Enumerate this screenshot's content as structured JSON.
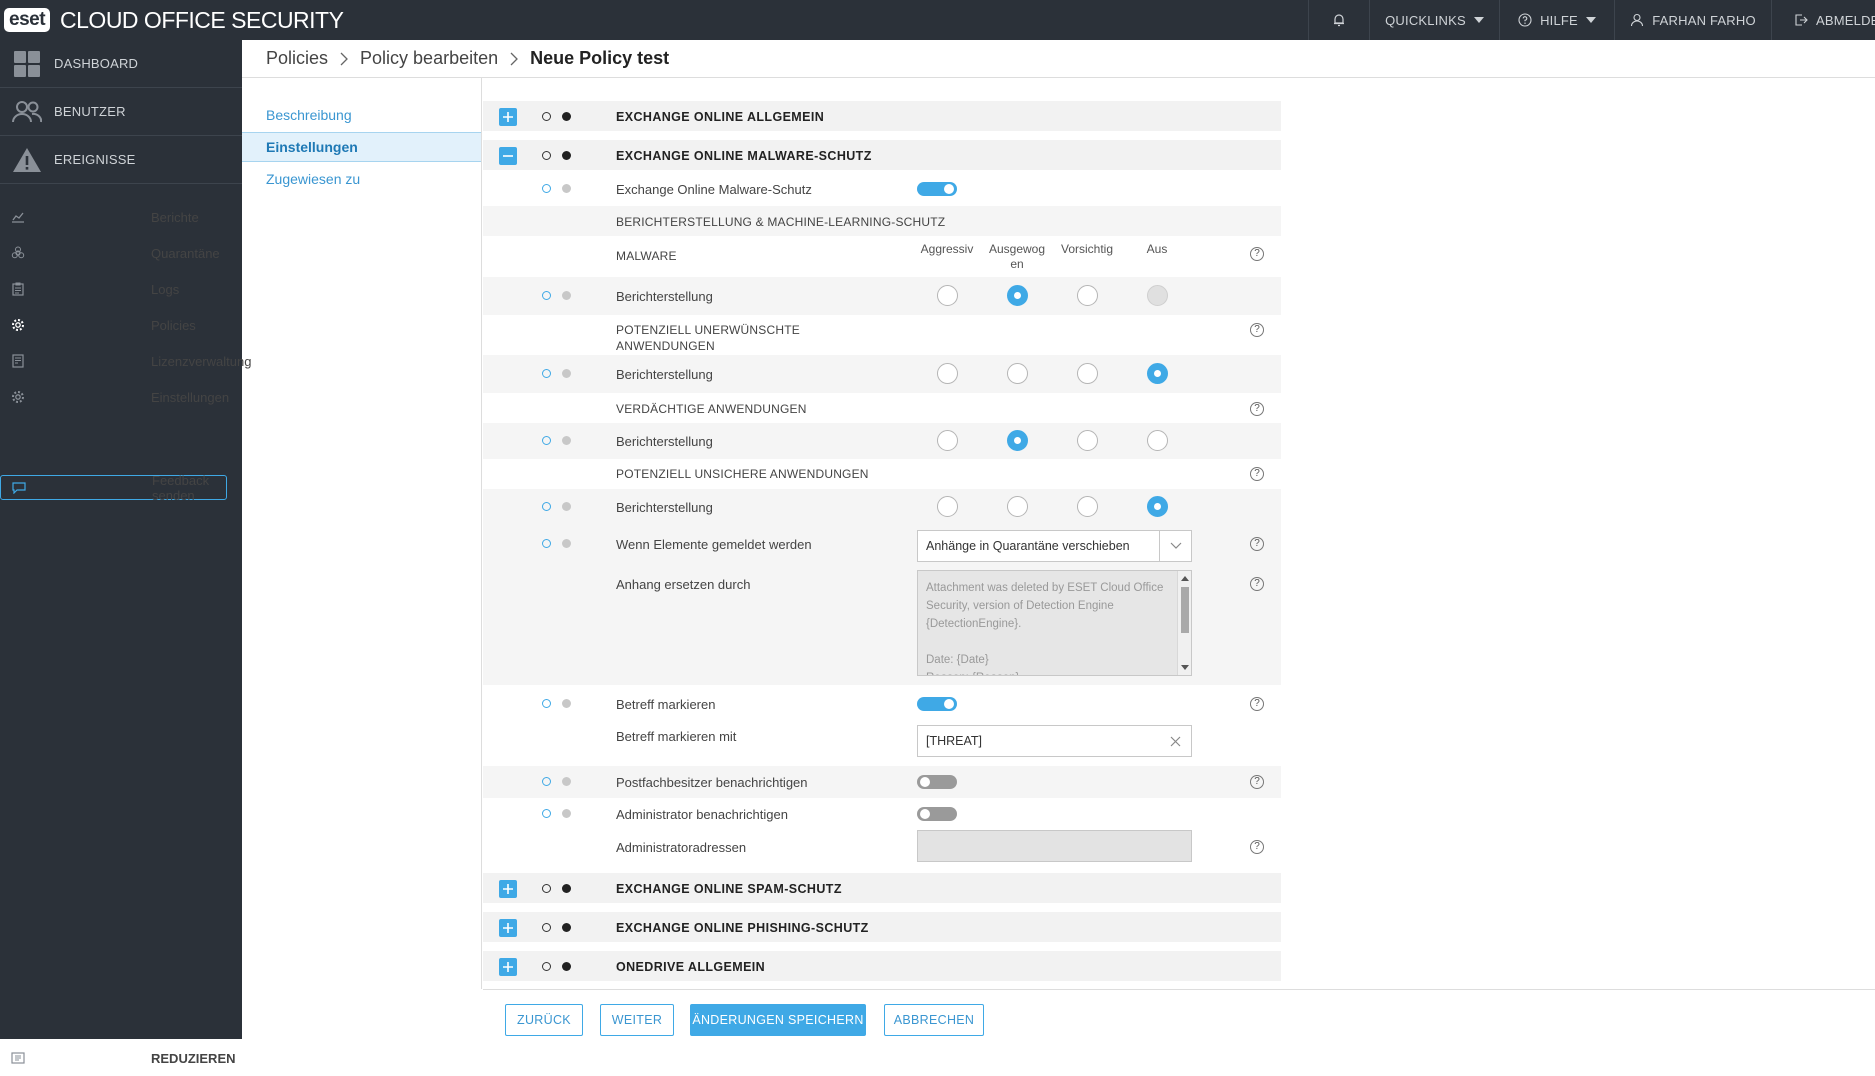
{
  "app": {
    "logo_badge": "eset",
    "title": "CLOUD OFFICE SECURITY"
  },
  "topbar": {
    "quicklinks": "QUICKLINKS",
    "help": "HILFE",
    "user": "FARHAN FARHO",
    "logout": "ABMELDEN"
  },
  "sidebar": {
    "main": [
      "DASHBOARD",
      "BENUTZER",
      "EREIGNISSE"
    ],
    "sub": [
      "Berichte",
      "Quarantäne",
      "Logs",
      "Policies",
      "Lizenzverwaltung",
      "Einstellungen"
    ],
    "active": "Policies",
    "feedback": "Feedback senden",
    "reduce": "REDUZIEREN"
  },
  "breadcrumb": {
    "items": [
      "Policies",
      "Policy bearbeiten"
    ],
    "current": "Neue Policy test"
  },
  "subnav": {
    "items": [
      "Beschreibung",
      "Einstellungen",
      "Zugewiesen zu"
    ],
    "active": "Einstellungen"
  },
  "sections": {
    "general": "EXCHANGE ONLINE ALLGEMEIN",
    "malware": "EXCHANGE ONLINE MALWARE-SCHUTZ",
    "spam": "EXCHANGE ONLINE SPAM-SCHUTZ",
    "phishing": "EXCHANGE ONLINE PHISHING-SCHUTZ",
    "onedrive": "ONEDRIVE ALLGEMEIN"
  },
  "malware": {
    "enable_label": "Exchange Online Malware-Schutz",
    "enable_on": true,
    "ml_header": "BERICHTERSTELLUNG & MACHINE-LEARNING-SCHUTZ",
    "columns": [
      "Aggressiv",
      "Ausgewogen",
      "Vorsichtig",
      "Aus"
    ],
    "categories": [
      {
        "title": "MALWARE",
        "row_label": "Berichterstellung",
        "selected": 1,
        "disabled": [
          3
        ]
      },
      {
        "title": "POTENZIELL UNERWÜNSCHTE ANWENDUNGEN",
        "row_label": "Berichterstellung",
        "selected": 3,
        "disabled": []
      },
      {
        "title": "VERDÄCHTIGE ANWENDUNGEN",
        "row_label": "Berichterstellung",
        "selected": 1,
        "disabled": []
      },
      {
        "title": "POTENZIELL UNSICHERE ANWENDUNGEN",
        "row_label": "Berichterstellung",
        "selected": 3,
        "disabled": []
      }
    ],
    "when_reported_label": "Wenn Elemente gemeldet werden",
    "when_reported_value": "Anhänge in Quarantäne verschieben",
    "replace_label": "Anhang ersetzen durch",
    "replace_text": "Attachment was deleted by ESET Cloud Office Security, version of Detection Engine {DetectionEngine}.\n\nDate: {Date}\nReason: {Reason}",
    "mark_subject_label": "Betreff markieren",
    "mark_subject_on": true,
    "mark_with_label": "Betreff markieren mit",
    "mark_with_value": "[THREAT]",
    "notify_owner_label": "Postfachbesitzer benachrichtigen",
    "notify_owner_on": false,
    "notify_admin_label": "Administrator benachrichtigen",
    "notify_admin_on": false,
    "admin_addresses_label": "Administratoradressen",
    "admin_addresses_value": ""
  },
  "footer": {
    "back": "ZURÜCK",
    "next": "WEITER",
    "save": "ÄNDERUNGEN SPEICHERN",
    "cancel": "ABBRECHEN"
  },
  "colors": {
    "accent": "#3fa9e6",
    "sidebar_bg": "#2b3139",
    "toggle_off": "#9a9a9a"
  }
}
